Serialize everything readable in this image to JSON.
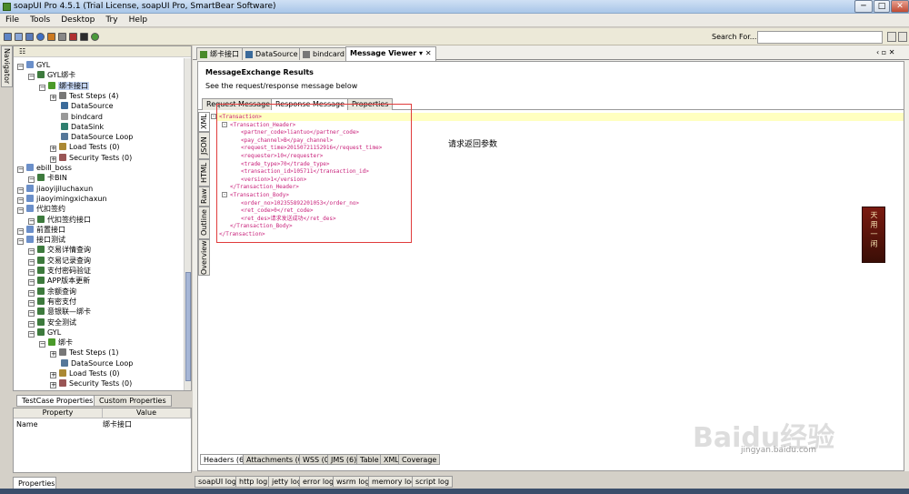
{
  "window": {
    "title": "soapUI Pro 4.5.1 (Trial License, soapUI Pro, SmartBear Software)",
    "minimize": "─",
    "maximize": "□",
    "close": "✕"
  },
  "menu": [
    "File",
    "Tools",
    "Desktop",
    "Try",
    "Help"
  ],
  "toolbar": {
    "search_label": "Search For...",
    "search_value": ""
  },
  "navigator": {
    "tab_label": "Navigator"
  },
  "tree": [
    {
      "label": "GYL",
      "level": 0,
      "icon": "project"
    },
    {
      "label": "GYL绑卡",
      "level": 1,
      "icon": "suite"
    },
    {
      "label": "绑卡接口",
      "level": 2,
      "icon": "testcase",
      "selected": true
    },
    {
      "label": "Test Steps (4)",
      "level": 3,
      "icon": "steps"
    },
    {
      "label": "DataSource",
      "level": 4,
      "icon": "datasource"
    },
    {
      "label": "bindcard",
      "level": 4,
      "icon": "request"
    },
    {
      "label": "DataSink",
      "level": 4,
      "icon": "datasink"
    },
    {
      "label": "DataSource Loop",
      "level": 4,
      "icon": "loop"
    },
    {
      "label": "Load Tests (0)",
      "level": 3,
      "icon": "load"
    },
    {
      "label": "Security Tests (0)",
      "level": 3,
      "icon": "security"
    },
    {
      "label": "ebill_boss",
      "level": 0,
      "icon": "project"
    },
    {
      "label": "卡BIN",
      "level": 1,
      "icon": "suite"
    },
    {
      "label": "jiaoyijiluchaxun",
      "level": 0,
      "icon": "project"
    },
    {
      "label": "jiaoyimingxichaxun",
      "level": 0,
      "icon": "project"
    },
    {
      "label": "代扣签约",
      "level": 0,
      "icon": "project"
    },
    {
      "label": "代扣签约接口",
      "level": 1,
      "icon": "suite"
    },
    {
      "label": "前置接口",
      "level": 0,
      "icon": "project"
    },
    {
      "label": "接口测试",
      "level": 0,
      "icon": "project"
    },
    {
      "label": "交易详情查询",
      "level": 1,
      "icon": "suite"
    },
    {
      "label": "交易记录查询",
      "level": 1,
      "icon": "suite"
    },
    {
      "label": "支付密码验证",
      "level": 1,
      "icon": "suite"
    },
    {
      "label": "APP版本更新",
      "level": 1,
      "icon": "suite"
    },
    {
      "label": "余额查询",
      "level": 1,
      "icon": "suite"
    },
    {
      "label": "有密支付",
      "level": 1,
      "icon": "suite"
    },
    {
      "label": "意银联—绑卡",
      "level": 1,
      "icon": "suite"
    },
    {
      "label": "安全测试",
      "level": 1,
      "icon": "suite"
    },
    {
      "label": "GYL",
      "level": 1,
      "icon": "suite"
    },
    {
      "label": "绑卡",
      "level": 2,
      "icon": "testcase"
    },
    {
      "label": "Test Steps (1)",
      "level": 3,
      "icon": "steps"
    },
    {
      "label": "DataSource Loop",
      "level": 4,
      "icon": "loop"
    },
    {
      "label": "Load Tests (0)",
      "level": 3,
      "icon": "load"
    },
    {
      "label": "Security Tests (0)",
      "level": 3,
      "icon": "security"
    }
  ],
  "props": {
    "tabs": [
      "TestCase Properties",
      "Custom Properties"
    ],
    "headers": [
      "Property",
      "Value"
    ],
    "rows": [
      {
        "name": "Name",
        "value": "绑卡接口"
      }
    ],
    "bottom_tab": "Properties"
  },
  "editor_tabs": [
    "绑卡接口",
    "DataSource",
    "bindcard",
    "Message Viewer"
  ],
  "viewer": {
    "title": "MessageExchange Results",
    "desc": "See the request/response message below",
    "tabs": [
      "Request Message",
      "Response Message",
      "Properties"
    ],
    "side_tabs": [
      "XML",
      "JSON",
      "HTML",
      "Raw",
      "Outline",
      "Overview"
    ],
    "lines": [
      {
        "indent": 0,
        "text": "<Transaction>",
        "fold": "-"
      },
      {
        "indent": 1,
        "text": "<Transaction_Header>",
        "fold": "-"
      },
      {
        "indent": 2,
        "text": "<partner_code>liantuo</partner_code>"
      },
      {
        "indent": 2,
        "text": "<pay_channel>B</pay_channel>"
      },
      {
        "indent": 2,
        "text": "<request_time>20150721152916</request_time>"
      },
      {
        "indent": 2,
        "text": "<requester>10</requester>"
      },
      {
        "indent": 2,
        "text": "<trade_type>70</trade_type>"
      },
      {
        "indent": 2,
        "text": "<transaction_id>105711</transaction_id>"
      },
      {
        "indent": 2,
        "text": "<version>1</version>"
      },
      {
        "indent": 1,
        "text": "</Transaction_Header>"
      },
      {
        "indent": 1,
        "text": "<Transaction_Body>",
        "fold": "-"
      },
      {
        "indent": 2,
        "text": "<order_no>102355892201053</order_no>"
      },
      {
        "indent": 2,
        "text": "<ret_code>0</ret_code>"
      },
      {
        "indent": 2,
        "text": "<ret_des>请求发送成功</ret_des>"
      },
      {
        "indent": 1,
        "text": "</Transaction_Body>"
      },
      {
        "indent": 0,
        "text": "</Transaction>"
      }
    ],
    "annotation": "请求返回参数",
    "bottom_tabs": [
      "Headers (6)",
      "Attachments (0)",
      "WSS (0)",
      "JMS (6)",
      "Table",
      "XML",
      "Coverage"
    ]
  },
  "log_tabs": [
    "soapUI log",
    "http log",
    "jetty log",
    "error log",
    "wsrm log",
    "memory log",
    "script log"
  ],
  "badge": "天 用 一 闲",
  "watermark": {
    "text": "Baidu经验",
    "url": "jingyan.baidu.com"
  },
  "colors": {
    "tag": "#c8207a",
    "highlight": "#ffffc0",
    "annot_box": "#e03c3c"
  }
}
